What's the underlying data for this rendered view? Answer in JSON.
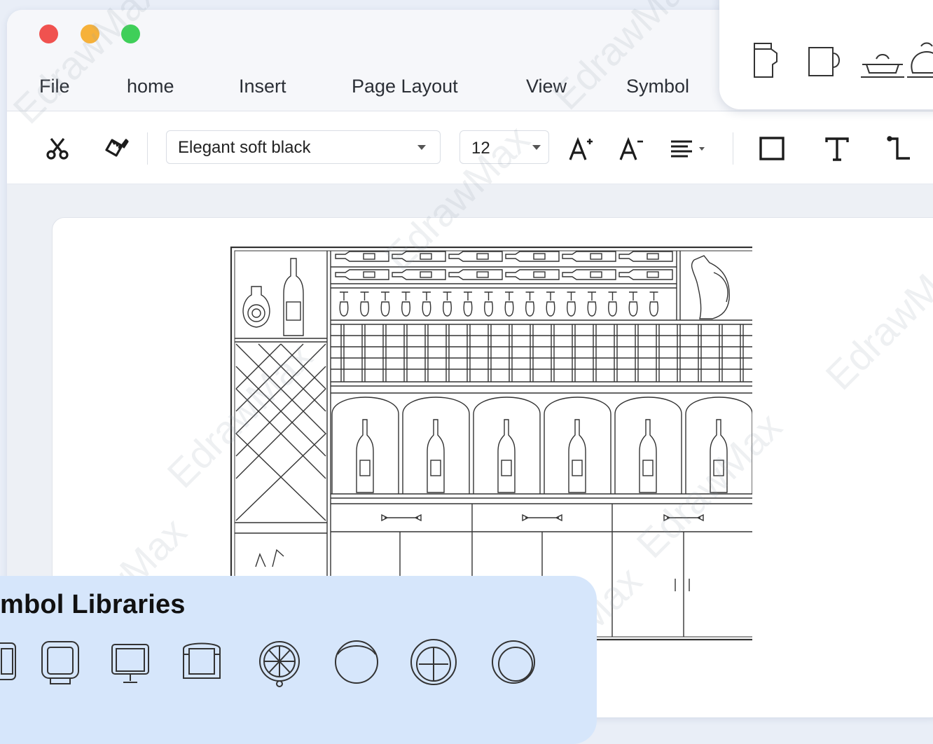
{
  "window": {
    "traffic_lights": [
      "close",
      "minimize",
      "maximize"
    ]
  },
  "menu": {
    "items": [
      "File",
      "home",
      "Insert",
      "Page Layout",
      "View",
      "Symbol"
    ]
  },
  "toolbar": {
    "cut_icon": "scissors-icon",
    "format_painter_icon": "paint-brush-icon",
    "font_family": "Elegant soft black",
    "font_size": "12",
    "increase_font_icon": "font-increase-icon",
    "decrease_font_icon": "font-decrease-icon",
    "align_icon": "align-left-icon",
    "shape_icon": "rectangle-icon",
    "text_icon": "text-tool-icon",
    "connector_icon": "connector-icon"
  },
  "canvas": {
    "drawing": "wine cabinet elevation",
    "watermark_text": "EdrawMax"
  },
  "symbol_libraries": {
    "title": "mbol Libraries",
    "icons": [
      "chair-icon",
      "armchair-icon",
      "office-chair-icon",
      "lounge-chair-icon",
      "swivel-chair-icon",
      "round-stool-icon",
      "round-chair-icon",
      "round-seat-icon"
    ]
  },
  "kitchen_symbols": {
    "icons": [
      "pitcher-icon",
      "mug-icon",
      "pot-icon",
      "kettle-icon"
    ]
  }
}
